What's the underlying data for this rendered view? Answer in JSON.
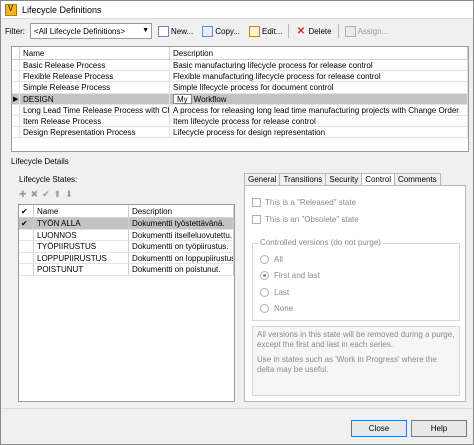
{
  "window": {
    "title": "Lifecycle Definitions"
  },
  "toolbar": {
    "filter_label": "Filter:",
    "filter_value": "<All Lifecycle Definitions>",
    "new_label": "New...",
    "copy_label": "Copy...",
    "edit_label": "Edit...",
    "delete_label": "Delete",
    "assign_label": "Assign..."
  },
  "definitions": {
    "headers": {
      "name": "Name",
      "description": "Description"
    },
    "rows": [
      {
        "name": "Basic Release Process",
        "description": "Basic manufacturing lifecycle process for release control"
      },
      {
        "name": "Flexible Release Process",
        "description": "Flexible manufacturing lifecycle process for release control"
      },
      {
        "name": "Simple Release Process",
        "description": "Simple lifecycle process for document control"
      },
      {
        "name": "DESIGN",
        "editor_text": "My",
        "description": "Workflow"
      },
      {
        "name": "Long Lead Time Release Process with Ch...",
        "description": "A process for releasing long lead time manufacturing projects with Change Order"
      },
      {
        "name": "Item Release Process",
        "description": "Item lifecycle process for release control"
      },
      {
        "name": "Design Representation Process",
        "description": "Lifecycle process for design representation"
      }
    ]
  },
  "details": {
    "section_label": "Lifecycle Details",
    "states_label": "Lifecycle States:",
    "states_headers": {
      "check": "✔",
      "name": "Name",
      "description": "Description"
    },
    "states": [
      {
        "check": "✔",
        "name": "TYÖN ALLA",
        "description": "Dokumentti työstettävänä."
      },
      {
        "check": "",
        "name": "LUONNOS",
        "description": "Dokumentti itselleluovutettu."
      },
      {
        "check": "",
        "name": "TYÖPIIRUSTUS",
        "description": "Dokumentti on työpiirustus."
      },
      {
        "check": "",
        "name": "LOPPUPIIRUSTUS",
        "description": "Dokumentti on loppupiirustus."
      },
      {
        "check": "",
        "name": "POISTUNUT",
        "description": "Dokumentti on poistunut."
      }
    ]
  },
  "tabs": [
    "General",
    "Transitions",
    "Security",
    "Control",
    "Comments"
  ],
  "control": {
    "released_label": "This is a \"Released\" state",
    "obsolete_label": "This is an \"Obsolete\" state",
    "group_title": "Controlled versions (do not purge)",
    "options": [
      "All",
      "First and last",
      "Last",
      "None"
    ],
    "note_p1": "All versions in this state will be removed during a purge, except the first and last in each series.",
    "note_p2": "Use in states such as 'Work in Progress' where the delta may be useful."
  },
  "footer": {
    "close_label": "Close",
    "help_label": "Help"
  }
}
